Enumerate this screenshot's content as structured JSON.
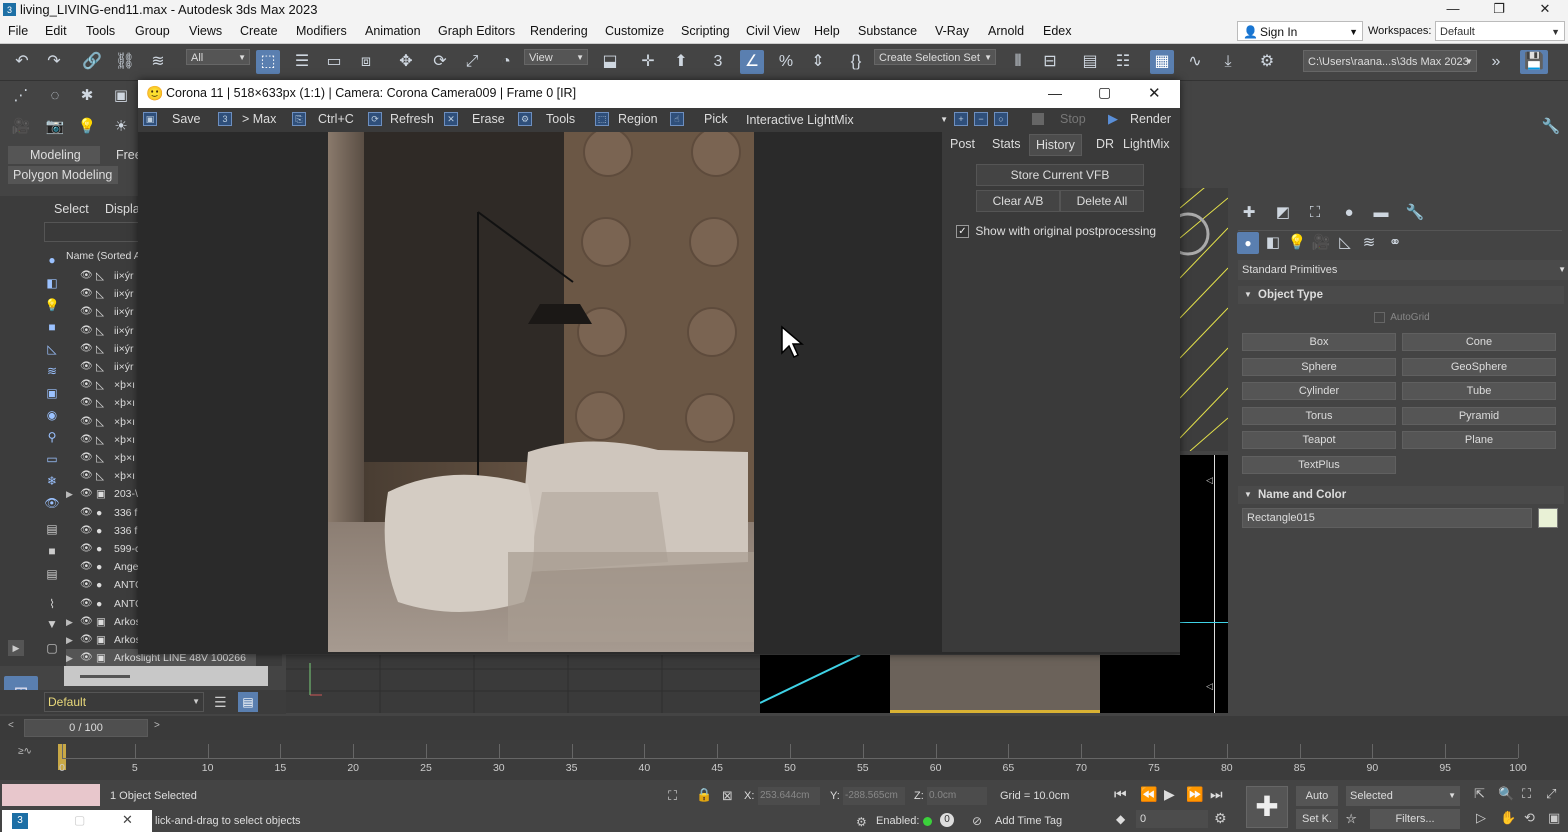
{
  "window": {
    "title": "living_LIVING-end11.max - Autodesk 3ds Max 2023",
    "min": "—",
    "max": "❐",
    "close": "✕"
  },
  "menu": [
    "File",
    "Edit",
    "Tools",
    "Group",
    "Views",
    "Create",
    "Modifiers",
    "Animation",
    "Graph Editors",
    "Rendering",
    "Customize",
    "Scripting",
    "Civil View",
    "Help",
    "Substance",
    "V-Ray",
    "Arnold",
    "Edex"
  ],
  "header_right": {
    "sign_in": "Sign In",
    "workspaces_label": "Workspaces:",
    "workspaces_value": "Default"
  },
  "toolbar": {
    "filter": "All",
    "ref_coord": "View",
    "selection_set": "Create Selection Set",
    "path": "C:\\Users\\raana...s\\3ds Max 2023"
  },
  "ribbon": {
    "tabs": [
      "Modeling",
      "Free"
    ],
    "active_panel": "Polygon Modeling"
  },
  "scene_explorer": {
    "tabs": [
      "Select",
      "Displa"
    ],
    "header": "Name (Sorted A",
    "rows": [
      {
        "name": "ii×ýr",
        "type": "shape"
      },
      {
        "name": "ii×ýr",
        "type": "shape"
      },
      {
        "name": "ii×ýr",
        "type": "shape"
      },
      {
        "name": "ii×ýr",
        "type": "shape"
      },
      {
        "name": "ii×ýr",
        "type": "shape"
      },
      {
        "name": "ii×ýr",
        "type": "shape"
      },
      {
        "name": "×þ×ı",
        "type": "shape"
      },
      {
        "name": "×þ×ı",
        "type": "shape"
      },
      {
        "name": "×þ×ı",
        "type": "shape"
      },
      {
        "name": "×þ×ı",
        "type": "shape"
      },
      {
        "name": "×þ×ı",
        "type": "shape"
      },
      {
        "name": "×þ×ı",
        "type": "shape"
      },
      {
        "name": "203-\\",
        "type": "group",
        "expand": true
      },
      {
        "name": "336 f",
        "type": "sphere"
      },
      {
        "name": "336 f",
        "type": "sphere"
      },
      {
        "name": "599-c",
        "type": "sphere"
      },
      {
        "name": "Ange",
        "type": "sphere"
      },
      {
        "name": "ANTC",
        "type": "sphere"
      },
      {
        "name": "ANTC",
        "type": "sphere"
      },
      {
        "name": "Arkos",
        "type": "group",
        "expand": true
      },
      {
        "name": "Arkos",
        "type": "group",
        "expand": true
      },
      {
        "name": "Arkoslight LINE 48V 100266",
        "type": "group",
        "expand": true
      }
    ]
  },
  "layer": {
    "value": "Default"
  },
  "vfb": {
    "title": "Corona 11 | 518×633px (1:1) | Camera: Corona Camera009 | Frame 0 [IR]",
    "tools": [
      "Save",
      "> Max",
      "Ctrl+C",
      "Refresh",
      "Erase",
      "Tools",
      "Region",
      "Pick"
    ],
    "lightmix": "Interactive LightMix",
    "stop": "Stop",
    "render": "Render",
    "tabs": [
      "Post",
      "Stats",
      "History",
      "DR",
      "LightMix"
    ],
    "active_tab": "History",
    "store_btn": "Store Current VFB",
    "clear_btn": "Clear A/B",
    "delete_btn": "Delete All",
    "checkbox_label": "Show with original postprocessing",
    "checkbox_checked": true
  },
  "command_panel": {
    "category": "Standard Primitives",
    "object_type_title": "Object Type",
    "autogrid": "AutoGrid",
    "buttons": [
      "Box",
      "Cone",
      "Sphere",
      "GeoSphere",
      "Cylinder",
      "Tube",
      "Torus",
      "Pyramid",
      "Teapot",
      "Plane",
      "TextPlus"
    ],
    "name_color_title": "Name and Color",
    "object_name": "Rectangle015",
    "object_color": "#e9f1d6"
  },
  "time": {
    "slider": "0 / 100",
    "ticks": [
      "0",
      "5",
      "10",
      "15",
      "20",
      "25",
      "30",
      "35",
      "40",
      "45",
      "50",
      "55",
      "60",
      "65",
      "70",
      "75",
      "80",
      "85",
      "90",
      "95",
      "100"
    ]
  },
  "status": {
    "selection": "1 Object Selected",
    "prompt": "lick-and-drag to select objects",
    "x_label": "X:",
    "x_val": "253.644cm",
    "y_label": "Y:",
    "y_val": "-288.565cm",
    "z_label": "Z:",
    "z_val": "0.0cm",
    "grid": "Grid = 10.0cm",
    "enabled": "Enabled:",
    "add_time_tag": "Add Time Tag",
    "auto": "Auto",
    "selected": "Selected",
    "set_key": "Set K.",
    "filters": "Filters...",
    "frame": "0"
  },
  "accent": "#5a7fb0"
}
